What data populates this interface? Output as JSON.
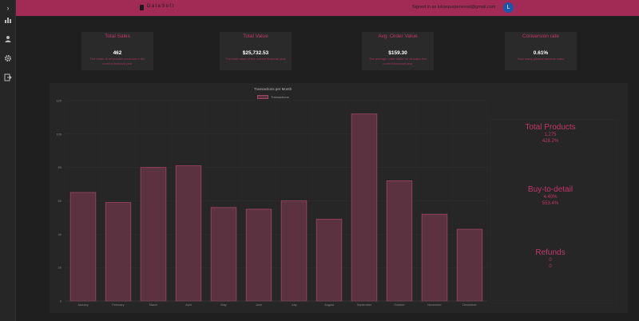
{
  "brand": {
    "name": "DataSoft"
  },
  "header": {
    "signed_in": "Signed in as lukaspurpersonal@gmail.com",
    "avatar_initial": "L"
  },
  "sidebar": {
    "icons": [
      "chevron-right-icon",
      "bar-chart-icon",
      "user-icon",
      "gear-icon",
      "logout-icon"
    ]
  },
  "cards": [
    {
      "title": "Total Sales",
      "value": "462",
      "desc": "The totals of all product products in the current financial year"
    },
    {
      "title": "Total Value",
      "value": "$25,732.53",
      "desc": "The total value of the current financial year"
    },
    {
      "title": "Avg. Order Value",
      "value": "$159.30",
      "desc": "The average order value for all sales this current financial year"
    },
    {
      "title": "Conversion rate",
      "value": "0.61%",
      "desc": "How many pitches become sales"
    }
  ],
  "stats": [
    {
      "title": "Total Products",
      "line1": "1,275",
      "line2": "428.2%"
    },
    {
      "title": "Buy-to-detail",
      "line1": "4.40%",
      "line2": "553.4%"
    },
    {
      "title": "Refunds",
      "line1": "0",
      "line2": "0"
    }
  ],
  "chart_data": {
    "type": "bar",
    "title": "Transactions per Month",
    "legend": "Transactions",
    "categories": [
      "January",
      "February",
      "March",
      "April",
      "May",
      "June",
      "July",
      "August",
      "September",
      "October",
      "November",
      "December"
    ],
    "values": [
      65,
      59,
      80,
      81,
      56,
      55,
      60,
      49,
      112,
      72,
      52,
      43
    ],
    "ylim": [
      0,
      120
    ],
    "yticks": [
      0,
      20,
      40,
      60,
      80,
      100,
      120
    ],
    "colors": {
      "fill": "#5b3240",
      "stroke": "#a04660"
    }
  }
}
